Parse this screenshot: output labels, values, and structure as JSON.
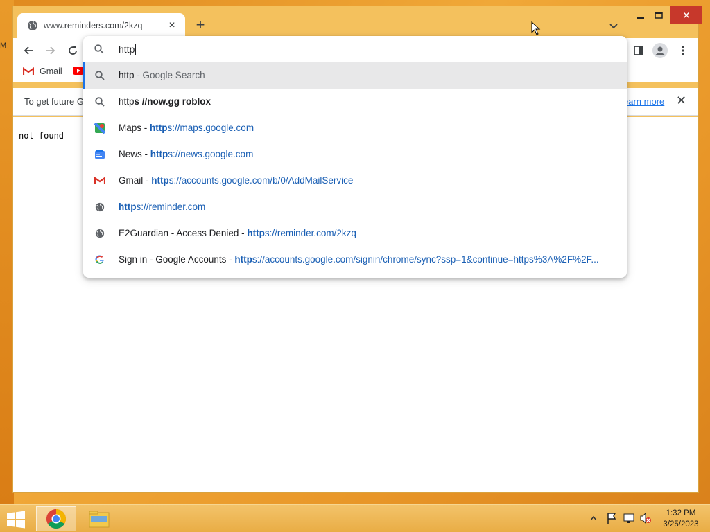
{
  "desktop": {
    "edge_letter": "M"
  },
  "browser": {
    "tab": {
      "title": "www.reminders.com/2kzq",
      "close_glyph": "×"
    },
    "newtab_glyph": "+",
    "window_close_glyph": "✕"
  },
  "bookmarks": {
    "gmail": "Gmail"
  },
  "infobar": {
    "message": "To get future G",
    "learn_more": "earn more",
    "close_glyph": "✕"
  },
  "page": {
    "body_text": "not found"
  },
  "omnibox": {
    "input_text": "http",
    "suggestions": [
      {
        "icon": "search-icon",
        "parts": [
          {
            "t": "http",
            "c": ""
          },
          {
            "t": " - Google Search",
            "c": "dim"
          }
        ]
      },
      {
        "icon": "search-icon",
        "parts": [
          {
            "t": "http",
            "c": ""
          },
          {
            "t": "s //now.gg roblox",
            "c": "bold"
          }
        ]
      },
      {
        "icon": "maps-icon",
        "parts": [
          {
            "t": "Maps - ",
            "c": ""
          },
          {
            "t": "http",
            "c": "url bold"
          },
          {
            "t": "s://maps.google.com",
            "c": "url"
          }
        ]
      },
      {
        "icon": "news-icon",
        "parts": [
          {
            "t": "News - ",
            "c": ""
          },
          {
            "t": "http",
            "c": "url bold"
          },
          {
            "t": "s://news.google.com",
            "c": "url"
          }
        ]
      },
      {
        "icon": "gmail-icon",
        "parts": [
          {
            "t": "Gmail - ",
            "c": ""
          },
          {
            "t": "http",
            "c": "url bold"
          },
          {
            "t": "s://accounts.google.com/b/0/AddMailService",
            "c": "url"
          }
        ]
      },
      {
        "icon": "globe-icon",
        "parts": [
          {
            "t": "http",
            "c": "url bold"
          },
          {
            "t": "s://reminder.com",
            "c": "url"
          }
        ]
      },
      {
        "icon": "globe-icon",
        "parts": [
          {
            "t": "E2Guardian - Access Denied - ",
            "c": ""
          },
          {
            "t": "http",
            "c": "url bold"
          },
          {
            "t": "s://reminder.com/2kzq",
            "c": "url"
          }
        ]
      },
      {
        "icon": "google-icon",
        "parts": [
          {
            "t": "Sign in - Google Accounts - ",
            "c": ""
          },
          {
            "t": "http",
            "c": "url bold"
          },
          {
            "t": "s://accounts.google.com/signin/chrome/sync?ssp=1&continue=https%3A%2F%2F...",
            "c": "url"
          }
        ]
      }
    ]
  },
  "taskbar": {
    "clock_time": "1:32 PM",
    "clock_date": "3/25/2023"
  },
  "colors": {
    "accent": "#1a73e8",
    "url": "#1a5fb4",
    "close_red": "#c7382b",
    "window_frame": "#f4c15d"
  }
}
